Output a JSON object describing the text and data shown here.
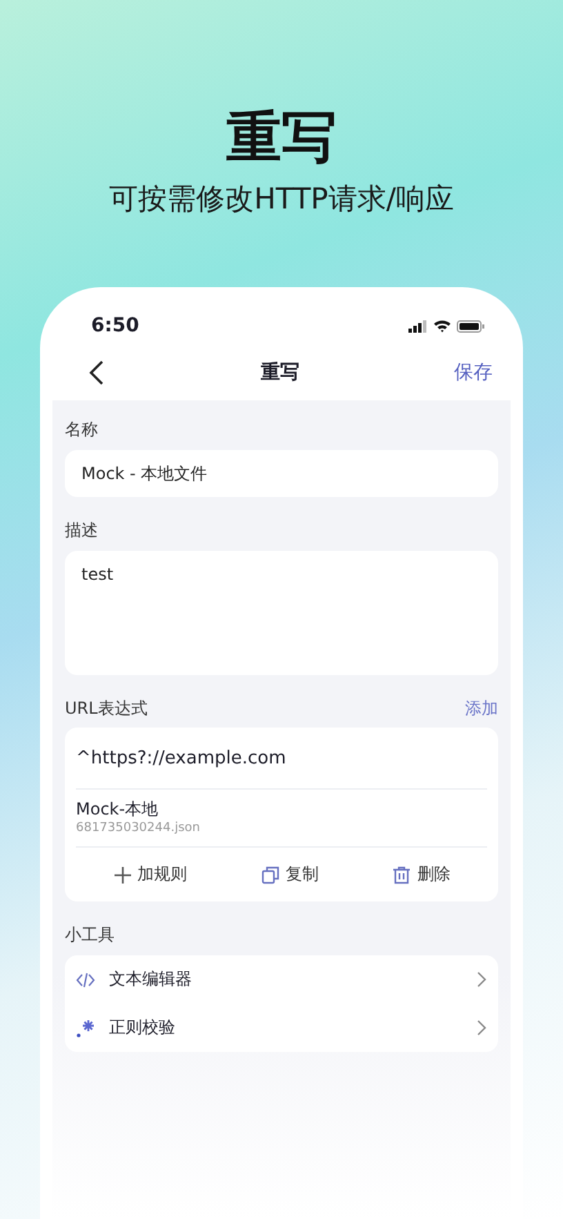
{
  "promo": {
    "title": "重写",
    "subtitle": "可按需修改HTTP请求/响应"
  },
  "status_bar": {
    "time": "6:50"
  },
  "nav": {
    "title": "重写",
    "action": "保存"
  },
  "fields": [
    {
      "label": "名称",
      "kind": "input",
      "value": "Mock - 本地文件"
    },
    {
      "label": "描述",
      "kind": "textarea",
      "value": "test"
    }
  ],
  "url_section": {
    "label": "URL表达式",
    "action": "添加",
    "expression": "^https?://example.com",
    "rule": {
      "name": "Mock-本地",
      "file": "681735030244.json"
    },
    "buttons": [
      {
        "kind": "add",
        "label": "加规则"
      },
      {
        "kind": "copy",
        "label": "复制"
      },
      {
        "kind": "delete",
        "label": "删除"
      }
    ]
  },
  "tools": {
    "label": "小工具",
    "items": [
      {
        "kind": "code",
        "label": "文本编辑器"
      },
      {
        "kind": "regex",
        "label": "正则校验"
      }
    ]
  }
}
